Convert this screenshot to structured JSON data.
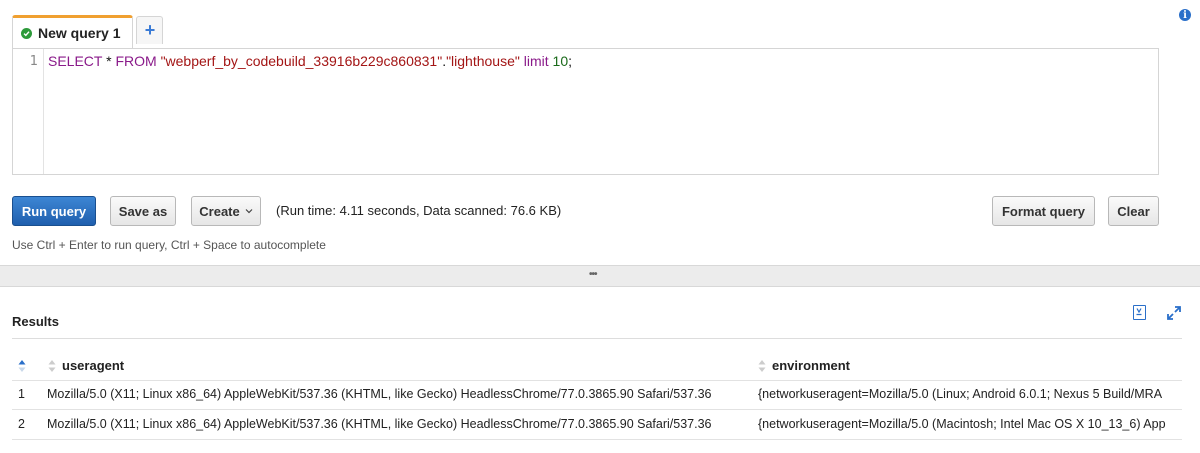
{
  "tabs": {
    "active_label": "New query 1",
    "add_label": "+"
  },
  "editor": {
    "line_number": "1",
    "query": {
      "kw_select": "SELECT",
      "star": " * ",
      "kw_from": "FROM",
      "table_db": "\"webperf_by_codebuild_33916b229c860831\"",
      "dot": ".",
      "table_name": "\"lighthouse\"",
      "kw_limit": "limit",
      "limit_value": "10",
      "terminator": ";"
    }
  },
  "toolbar": {
    "run_label": "Run query",
    "save_label": "Save as",
    "create_label": "Create",
    "status": "(Run time: 4.11 seconds, Data scanned: 76.6 KB)",
    "format_label": "Format query",
    "clear_label": "Clear"
  },
  "hint": "Use Ctrl + Enter to run query, Ctrl + Space to autocomplete",
  "results": {
    "title": "Results",
    "columns": [
      "useragent",
      "environment"
    ],
    "rows": [
      {
        "index": "1",
        "useragent": "Mozilla/5.0 (X11; Linux x86_64) AppleWebKit/537.36 (KHTML, like Gecko) HeadlessChrome/77.0.3865.90 Safari/537.36",
        "environment": "{networkuseragent=Mozilla/5.0 (Linux; Android 6.0.1; Nexus 5 Build/MRA"
      },
      {
        "index": "2",
        "useragent": "Mozilla/5.0 (X11; Linux x86_64) AppleWebKit/537.36 (KHTML, like Gecko) HeadlessChrome/77.0.3865.90 Safari/537.36",
        "environment": "{networkuseragent=Mozilla/5.0 (Macintosh; Intel Mac OS X 10_13_6) App"
      }
    ]
  },
  "colors": {
    "accent_tab": "#f0a030",
    "primary_button": "#1f5fae",
    "keyword": "#8a1a8a",
    "string": "#a31515",
    "number": "#1a6a1a",
    "icon_blue": "#2a6fc9"
  },
  "icons": [
    "check-icon",
    "plus-icon",
    "info-icon",
    "chevron-down-icon",
    "drag-handle-icon",
    "pdf-download-icon",
    "expand-icon",
    "sort-asc-icon",
    "sort-icon"
  ]
}
